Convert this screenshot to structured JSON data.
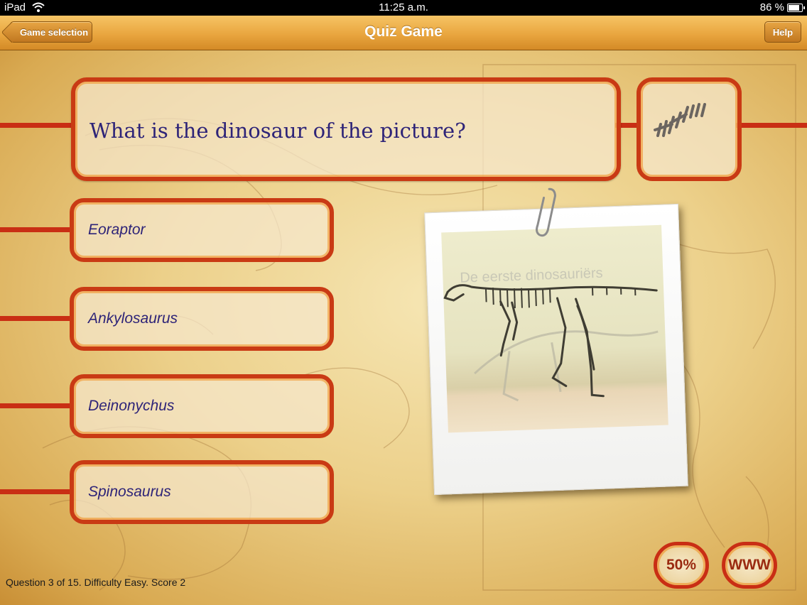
{
  "status_bar": {
    "carrier": "iPad",
    "time": "11:25 a.m.",
    "battery": "86 %",
    "battery_level": 0.86
  },
  "nav": {
    "back_label": "Game selection",
    "title": "Quiz Game",
    "help_label": "Help"
  },
  "question": {
    "text": "What is the dinosaur of the picture?"
  },
  "answers": [
    {
      "label": "Eoraptor"
    },
    {
      "label": "Ankylosaurus"
    },
    {
      "label": "Deinonychus"
    },
    {
      "label": "Spinosaurus"
    }
  ],
  "photo": {
    "caption_in_photo": "De eerste dinosauriërs"
  },
  "lifelines": {
    "fifty_fifty": "50%",
    "www": "WWW"
  },
  "footer": {
    "status": "Question 3 of 15. Difficulty Easy. Score 2"
  },
  "colors": {
    "frame_red": "#c93a14",
    "answer_text": "#2e2478",
    "nav_orange": "#e9a63f"
  },
  "icons": [
    "wifi-icon",
    "battery-icon",
    "back-chevron-icon",
    "tally-marks-icon",
    "paperclip-icon"
  ]
}
